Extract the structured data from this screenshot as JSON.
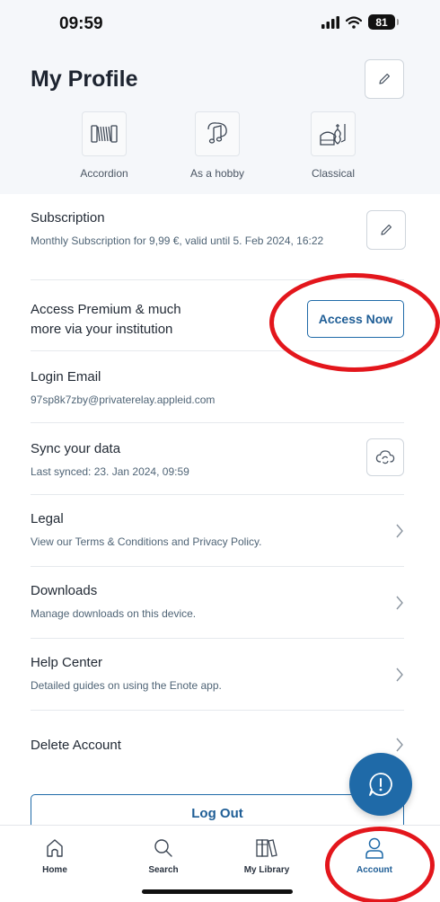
{
  "status_bar": {
    "time": "09:59",
    "battery": "81"
  },
  "profile": {
    "title": "My Profile",
    "tags": [
      {
        "label": "Accordion",
        "icon": "accordion-icon"
      },
      {
        "label": "As a hobby",
        "icon": "music-note-icon"
      },
      {
        "label": "Classical",
        "icon": "classical-icon"
      }
    ]
  },
  "subscription": {
    "title": "Subscription",
    "detail": "Monthly Subscription for 9,99 €, valid until 5. Feb 2024, 16:22"
  },
  "institution": {
    "title_line1": "Access Premium & much",
    "title_line2": "more via your institution",
    "button": "Access Now"
  },
  "login": {
    "title": "Login Email",
    "email": "97sp8k7zby@privaterelay.appleid.com"
  },
  "sync": {
    "title": "Sync your data",
    "detail": "Last synced: 23. Jan 2024, 09:59"
  },
  "legal": {
    "title": "Legal",
    "detail": "View our Terms & Conditions and Privacy Policy."
  },
  "downloads": {
    "title": "Downloads",
    "detail": "Manage downloads on this device."
  },
  "help": {
    "title": "Help Center",
    "detail": "Detailed guides on using the Enote app."
  },
  "delete": {
    "title": "Delete Account"
  },
  "logout": {
    "label": "Log Out"
  },
  "tabs": [
    {
      "label": "Home",
      "icon": "home-icon"
    },
    {
      "label": "Search",
      "icon": "search-icon"
    },
    {
      "label": "My Library",
      "icon": "library-icon"
    },
    {
      "label": "Account",
      "icon": "account-icon",
      "active": true
    }
  ],
  "colors": {
    "accent": "#1f6aa8",
    "annotation": "#e3161c",
    "header_bg": "#f5f7fa"
  }
}
